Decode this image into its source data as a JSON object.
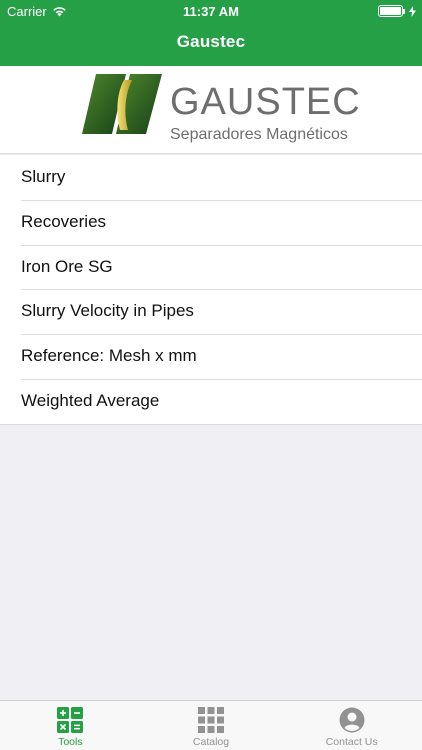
{
  "status_bar": {
    "carrier": "Carrier",
    "time": "11:37 AM",
    "battery_level": 1.0
  },
  "nav": {
    "title": "Gaustec"
  },
  "logo": {
    "name": "GAUSTEC",
    "tagline": "Separadores Magnéticos"
  },
  "menu": {
    "items": [
      {
        "label": "Slurry"
      },
      {
        "label": "Recoveries"
      },
      {
        "label": "Iron Ore SG"
      },
      {
        "label": "Slurry Velocity in Pipes"
      },
      {
        "label": "Reference: Mesh x mm"
      },
      {
        "label": "Weighted Average"
      }
    ]
  },
  "tab_bar": {
    "tabs": [
      {
        "label": "Tools",
        "icon": "calculator-icon",
        "active": true
      },
      {
        "label": "Catalog",
        "icon": "grid-icon",
        "active": false
      },
      {
        "label": "Contact Us",
        "icon": "person-icon",
        "active": false
      }
    ]
  },
  "colors": {
    "brand": "#26a047",
    "logo_dark": "#1f4f1c",
    "logo_gold": "#d9c44a",
    "tab_inactive": "#929292"
  }
}
